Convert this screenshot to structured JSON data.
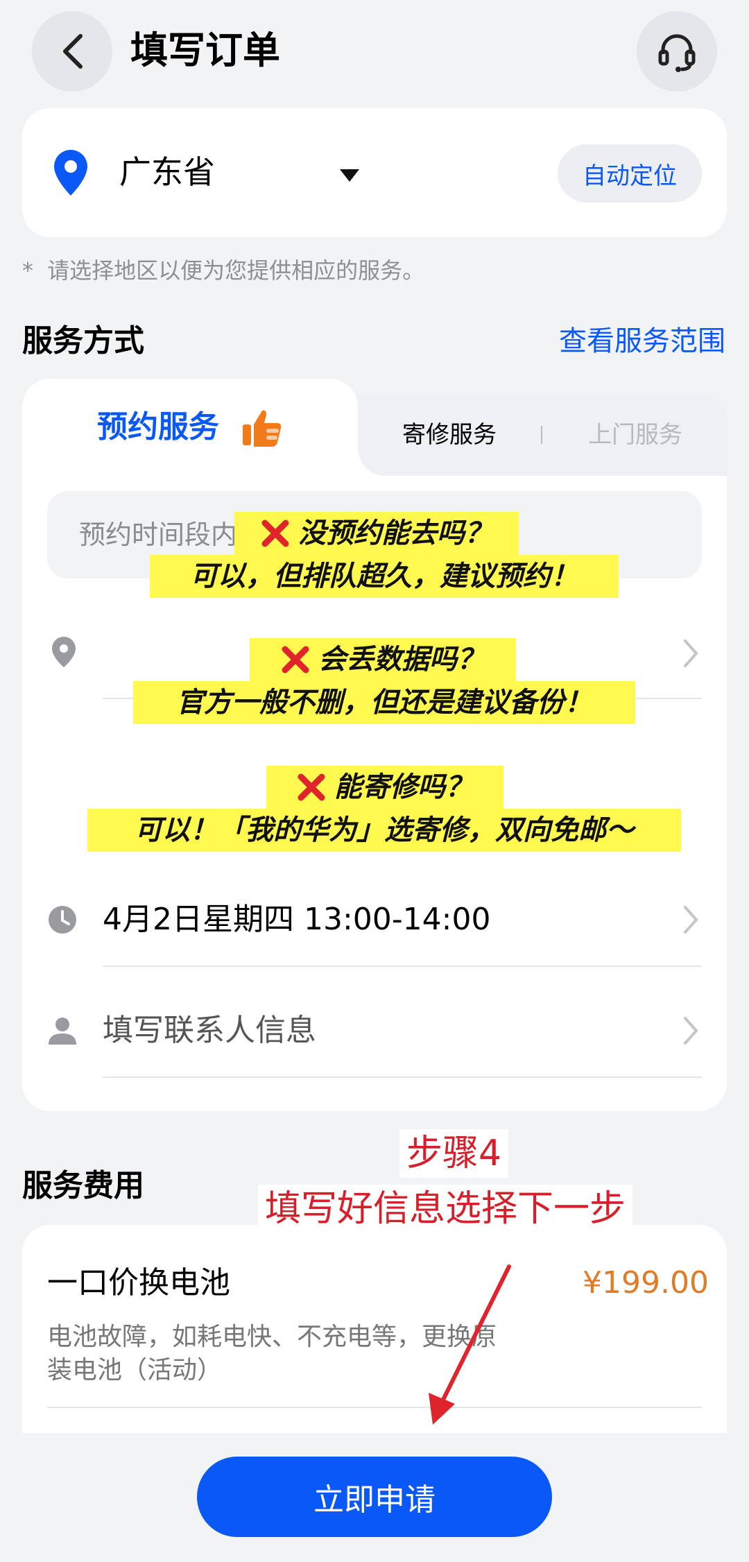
{
  "header": {
    "title": "填写订单",
    "back_icon": "back-arrow-icon",
    "service_icon": "headset-icon"
  },
  "location": {
    "province": "广东省",
    "auto_locate": "自动定位",
    "hint": "请选择地区以便为您提供相应的服务。"
  },
  "service_mode": {
    "title": "服务方式",
    "range_link": "查看服务范围",
    "tabs": [
      {
        "label": "预约服务",
        "active": true
      },
      {
        "label": "寄修服务",
        "active": false
      },
      {
        "label": "上门服务",
        "active": false
      }
    ],
    "time_placeholder": "预约时间段内",
    "datetime": "4月2日星期四 13:00-14:00",
    "contact": "填写联系人信息"
  },
  "annotations": [
    {
      "q": "没预约能去吗？",
      "a": "可以，但排队超久，建议预约！"
    },
    {
      "q": "会丢数据吗？",
      "a": "官方一般不删，但还是建议备份！"
    },
    {
      "q": "能寄修吗？",
      "a": "可以！「我的华为」选寄修，双向免邮～"
    }
  ],
  "step_note": {
    "step": "步骤4",
    "text": "填写好信息选择下一步"
  },
  "fee": {
    "title": "服务费用",
    "item_name": "一口价换电池",
    "price": "¥199.00",
    "desc_line1": "电池故障，如耗电快、不充电等，更换原",
    "desc_line2": "装电池（活动）"
  },
  "submit_label": "立即申请",
  "colors": {
    "accent": "#0a59f7",
    "price": "#e07b27",
    "highlight": "#fff94f",
    "annotation_red": "#d61f2a"
  }
}
